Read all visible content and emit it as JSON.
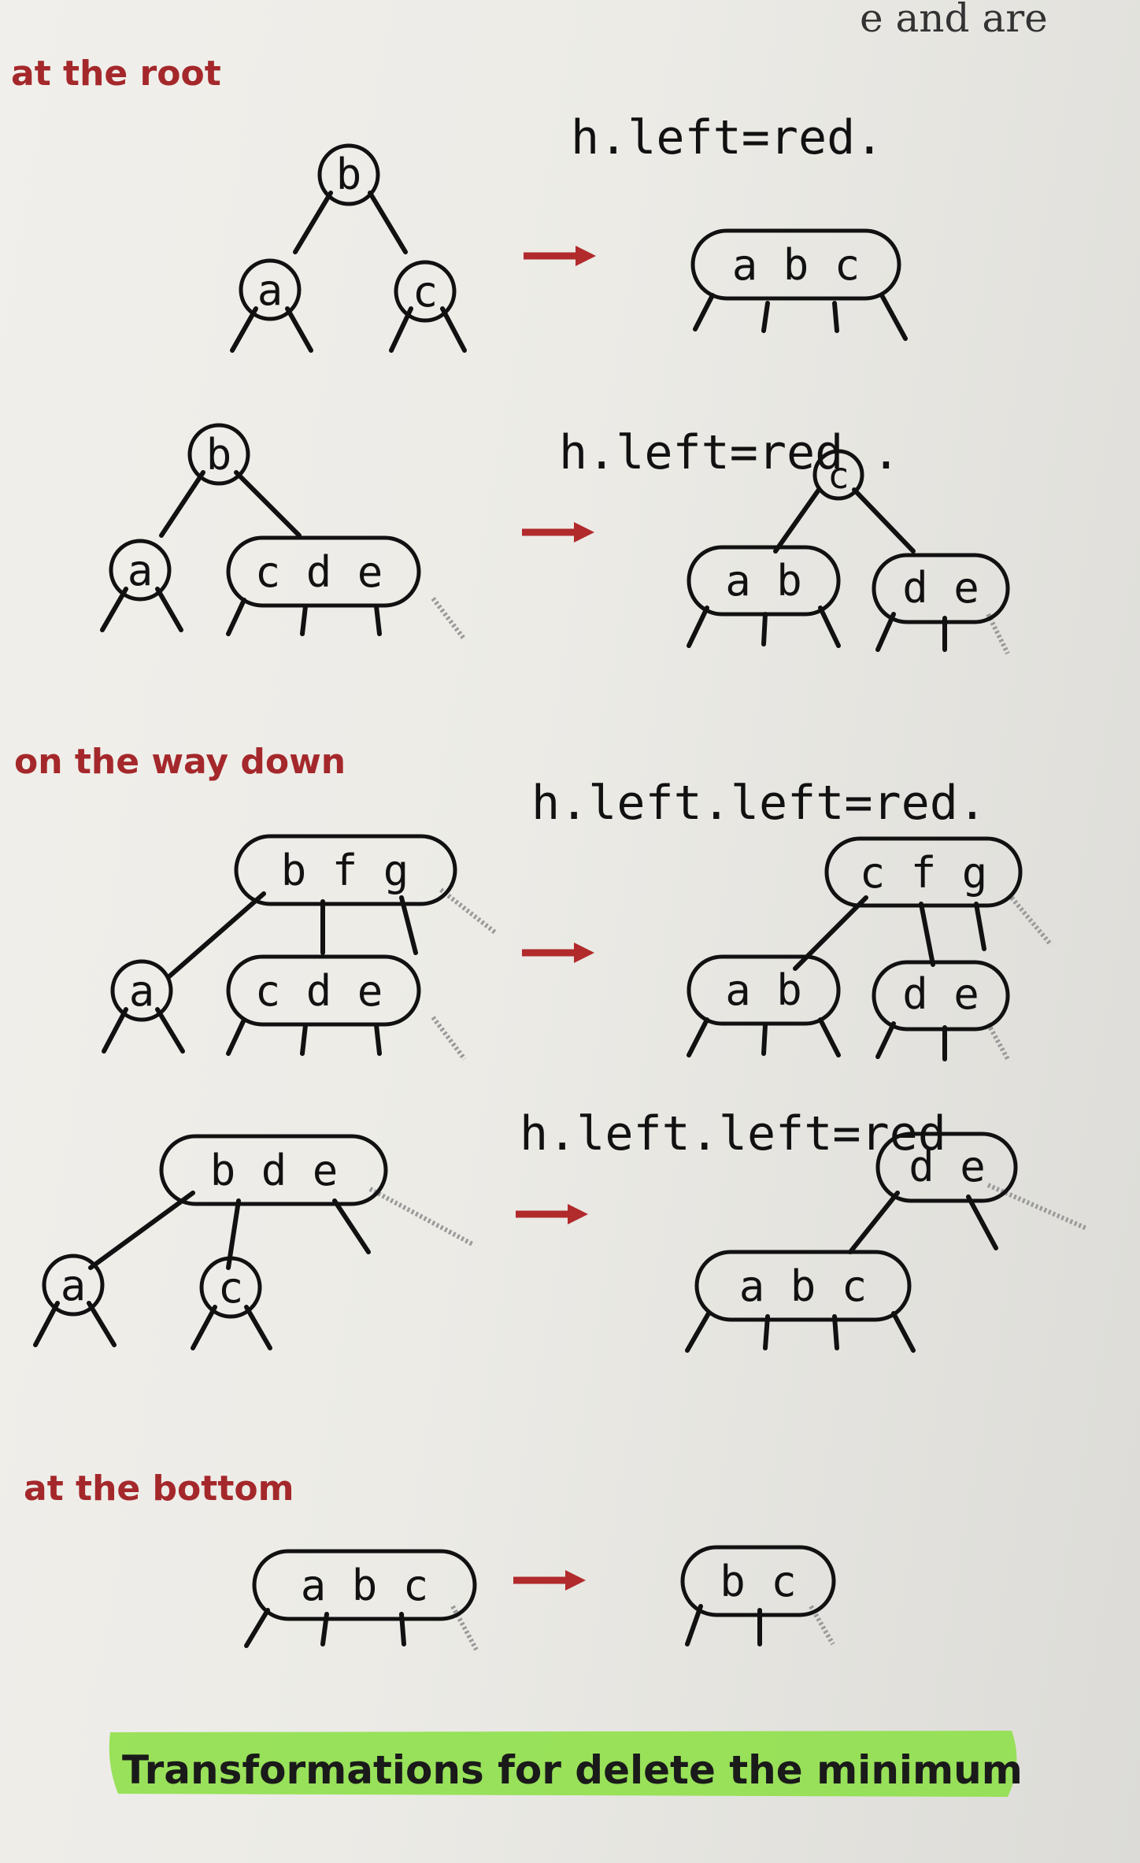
{
  "top_fragment": "e and are",
  "sections": {
    "root": "at the root",
    "way_down": "on the way down",
    "bottom": "at the bottom"
  },
  "notes": {
    "n1": "h.left=red.",
    "n2": "h.left=red .",
    "n3": "h.left.left=red.",
    "n4": "h.left.left=red"
  },
  "caption": "Transformations for delete the minimum",
  "colors": {
    "section_heading": "#a4282b",
    "arrow": "#b12a2c",
    "highlight": "#8fe04a",
    "ink": "#111111",
    "dimmed_key": "#a9a9a9"
  },
  "diagrams": [
    {
      "left": [
        "b",
        "a",
        "c"
      ],
      "right": [
        "a b c"
      ]
    },
    {
      "left": [
        "b",
        "a",
        "c d e"
      ],
      "right": [
        "c",
        "a b",
        "d e"
      ]
    },
    {
      "left": [
        "b f g",
        "a",
        "c d e"
      ],
      "right": [
        "c f g",
        "a b",
        "d e"
      ]
    },
    {
      "left": [
        "b d e",
        "a",
        "c"
      ],
      "right": [
        "d e",
        "a b c"
      ]
    },
    {
      "left": [
        "a b c"
      ],
      "right": [
        "b c"
      ]
    }
  ]
}
